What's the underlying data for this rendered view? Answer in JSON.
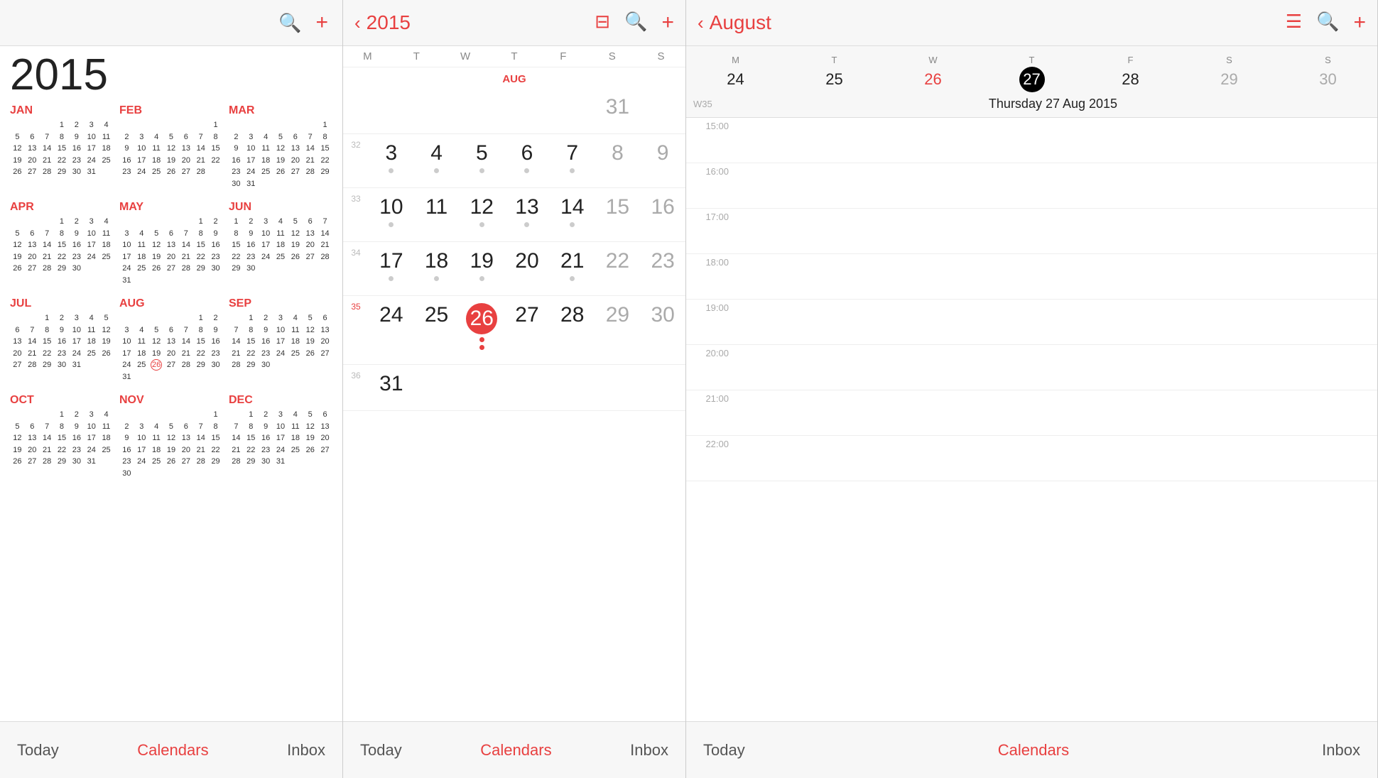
{
  "panel1": {
    "year": "2015",
    "toolbar": {
      "search_label": "search",
      "add_label": "add"
    },
    "months": [
      {
        "name": "JAN",
        "weeks": [
          [
            "",
            "",
            "",
            "1",
            "2",
            "3",
            "4"
          ],
          [
            "5",
            "6",
            "7",
            "8",
            "9",
            "10",
            "11"
          ],
          [
            "12",
            "13",
            "14",
            "15",
            "16",
            "17",
            "18"
          ],
          [
            "19",
            "20",
            "21",
            "22",
            "23",
            "24",
            "25"
          ],
          [
            "26",
            "27",
            "28",
            "29",
            "30",
            "31",
            ""
          ]
        ]
      },
      {
        "name": "FEB",
        "weeks": [
          [
            "",
            "",
            "",
            "",
            "",
            "",
            "1"
          ],
          [
            "2",
            "3",
            "4",
            "5",
            "6",
            "7",
            "8"
          ],
          [
            "9",
            "10",
            "11",
            "12",
            "13",
            "14",
            "15"
          ],
          [
            "16",
            "17",
            "18",
            "19",
            "20",
            "21",
            "22"
          ],
          [
            "23",
            "24",
            "25",
            "26",
            "27",
            "28",
            ""
          ]
        ]
      },
      {
        "name": "MAR",
        "weeks": [
          [
            "",
            "",
            "",
            "",
            "",
            "",
            "1"
          ],
          [
            "2",
            "3",
            "4",
            "5",
            "6",
            "7",
            "8"
          ],
          [
            "9",
            "10",
            "11",
            "12",
            "13",
            "14",
            "15"
          ],
          [
            "16",
            "17",
            "18",
            "19",
            "20",
            "21",
            "22"
          ],
          [
            "23",
            "24",
            "25",
            "26",
            "27",
            "28",
            "29"
          ],
          [
            "30",
            "31",
            "",
            "",
            "",
            "",
            ""
          ]
        ]
      },
      {
        "name": "APR",
        "weeks": [
          [
            "",
            "",
            "",
            "1",
            "2",
            "3",
            "4",
            "5"
          ],
          [
            "6",
            "7",
            "8",
            "9",
            "10",
            "11",
            "12"
          ],
          [
            "13",
            "14",
            "15",
            "16",
            "17",
            "18",
            "19"
          ],
          [
            "20",
            "21",
            "22",
            "23",
            "24",
            "25",
            "26"
          ],
          [
            "27",
            "28",
            "29",
            "30",
            "",
            "",
            ""
          ]
        ]
      },
      {
        "name": "MAY",
        "weeks": [
          [
            "",
            "",
            "",
            "",
            "",
            "1",
            "2",
            "3"
          ],
          [
            "4",
            "5",
            "6",
            "7",
            "8",
            "9",
            "10"
          ],
          [
            "11",
            "12",
            "13",
            "14",
            "15",
            "16",
            "17"
          ],
          [
            "18",
            "19",
            "20",
            "21",
            "22",
            "23",
            "24"
          ],
          [
            "25",
            "26",
            "27",
            "28",
            "29",
            "30",
            "31"
          ]
        ]
      },
      {
        "name": "JUN",
        "weeks": [
          [
            "1",
            "2",
            "3",
            "4",
            "5",
            "6",
            "7"
          ],
          [
            "8",
            "9",
            "10",
            "11",
            "12",
            "13",
            "14"
          ],
          [
            "15",
            "16",
            "17",
            "18",
            "19",
            "20",
            "21"
          ],
          [
            "22",
            "23",
            "24",
            "25",
            "26",
            "27",
            "28"
          ],
          [
            "29",
            "30",
            "",
            "",
            "",
            "",
            ""
          ]
        ]
      },
      {
        "name": "JUL",
        "weeks": [
          [
            "",
            "",
            "1",
            "2",
            "3",
            "4",
            "5"
          ],
          [
            "6",
            "7",
            "8",
            "9",
            "10",
            "11",
            "12"
          ],
          [
            "13",
            "14",
            "15",
            "16",
            "17",
            "18",
            "19"
          ],
          [
            "20",
            "21",
            "22",
            "23",
            "24",
            "25",
            "26"
          ],
          [
            "27",
            "28",
            "29",
            "30",
            "31",
            "",
            ""
          ]
        ]
      },
      {
        "name": "AUG",
        "weeks": [
          [
            "",
            "",
            "",
            "",
            "",
            "1",
            "2"
          ],
          [
            "3",
            "4",
            "5",
            "6",
            "7",
            "8",
            "9"
          ],
          [
            "10",
            "11",
            "12",
            "13",
            "14",
            "15",
            "16"
          ],
          [
            "17",
            "18",
            "19",
            "20",
            "21",
            "22",
            "23"
          ],
          [
            "24",
            "25",
            "26",
            "27",
            "28",
            "29",
            "30"
          ],
          [
            "31",
            "",
            "",
            "",
            "",
            "",
            ""
          ]
        ]
      },
      {
        "name": "SEP",
        "weeks": [
          [
            "",
            "1",
            "2",
            "3",
            "4",
            "5",
            "6"
          ],
          [
            "7",
            "8",
            "9",
            "10",
            "11",
            "12",
            "13"
          ],
          [
            "14",
            "15",
            "16",
            "17",
            "18",
            "19",
            "20"
          ],
          [
            "21",
            "22",
            "23",
            "24",
            "25",
            "26",
            "27"
          ],
          [
            "28",
            "29",
            "30",
            "",
            "",
            "",
            ""
          ]
        ]
      },
      {
        "name": "OCT",
        "weeks": [
          [
            "",
            "",
            "",
            "1",
            "2",
            "3",
            "4"
          ],
          [
            "5",
            "6",
            "7",
            "8",
            "9",
            "10",
            "11"
          ],
          [
            "12",
            "13",
            "14",
            "15",
            "16",
            "17",
            "18"
          ],
          [
            "19",
            "20",
            "21",
            "22",
            "23",
            "24",
            "25"
          ],
          [
            "26",
            "27",
            "28",
            "29",
            "30",
            "31",
            ""
          ]
        ]
      },
      {
        "name": "NOV",
        "weeks": [
          [
            "",
            "",
            "",
            "",
            "",
            "",
            "1"
          ],
          [
            "2",
            "3",
            "4",
            "5",
            "6",
            "7",
            "8"
          ],
          [
            "9",
            "10",
            "11",
            "12",
            "13",
            "14",
            "15"
          ],
          [
            "16",
            "17",
            "18",
            "19",
            "20",
            "21",
            "22"
          ],
          [
            "23",
            "24",
            "25",
            "26",
            "27",
            "28",
            "29"
          ],
          [
            "30",
            "",
            "",
            "",
            "",
            "",
            ""
          ]
        ]
      },
      {
        "name": "DEC",
        "weeks": [
          [
            "",
            "1",
            "2",
            "3",
            "4",
            "5",
            "6"
          ],
          [
            "7",
            "8",
            "9",
            "10",
            "11",
            "12",
            "13"
          ],
          [
            "14",
            "15",
            "16",
            "17",
            "18",
            "19",
            "20"
          ],
          [
            "21",
            "22",
            "23",
            "24",
            "25",
            "26",
            "27"
          ],
          [
            "28",
            "29",
            "30",
            "31",
            "",
            "",
            ""
          ]
        ]
      }
    ],
    "nav": {
      "today": "Today",
      "calendars": "Calendars",
      "inbox": "Inbox"
    }
  },
  "panel2": {
    "year": "2015",
    "month_name": "AUG",
    "dow_headers": [
      "M",
      "T",
      "W",
      "T",
      "F",
      "S",
      "S"
    ],
    "toolbar": {
      "back": "‹",
      "calendar_icon": "calendar",
      "search": "search",
      "add": "add"
    },
    "weeks": [
      {
        "week_num": "",
        "days": [
          {
            "num": "",
            "other": true
          },
          {
            "num": "",
            "other": true
          },
          {
            "num": "",
            "other": true
          },
          {
            "num": "",
            "other": true
          },
          {
            "num": "",
            "other": true
          },
          {
            "num": "31",
            "other": true
          },
          {
            "num": "",
            "other": true
          }
        ]
      },
      {
        "week_num": "32",
        "days": [
          {
            "num": "3",
            "other": false
          },
          {
            "num": "4",
            "other": false
          },
          {
            "num": "5",
            "other": false
          },
          {
            "num": "6",
            "other": false
          },
          {
            "num": "7",
            "other": false
          },
          {
            "num": "8",
            "weekend": true
          },
          {
            "num": "9",
            "weekend": true
          }
        ]
      },
      {
        "week_num": "33",
        "days": [
          {
            "num": "10",
            "other": false
          },
          {
            "num": "11",
            "other": false
          },
          {
            "num": "12",
            "other": false
          },
          {
            "num": "13",
            "other": false
          },
          {
            "num": "14",
            "other": false
          },
          {
            "num": "15",
            "weekend": true
          },
          {
            "num": "16",
            "weekend": true
          }
        ]
      },
      {
        "week_num": "34",
        "days": [
          {
            "num": "17",
            "other": false
          },
          {
            "num": "18",
            "other": false
          },
          {
            "num": "19",
            "other": false
          },
          {
            "num": "20",
            "other": false
          },
          {
            "num": "21",
            "other": false
          },
          {
            "num": "22",
            "weekend": true
          },
          {
            "num": "23",
            "weekend": true
          }
        ]
      },
      {
        "week_num": "35",
        "days": [
          {
            "num": "24",
            "other": false
          },
          {
            "num": "25",
            "other": false
          },
          {
            "num": "26",
            "selected": true
          },
          {
            "num": "27",
            "other": false
          },
          {
            "num": "28",
            "other": false
          },
          {
            "num": "29",
            "weekend": true
          },
          {
            "num": "30",
            "weekend": true
          }
        ]
      },
      {
        "week_num": "36",
        "days": [
          {
            "num": "31",
            "other": false
          },
          {
            "num": "",
            "other": true
          },
          {
            "num": "",
            "other": true
          },
          {
            "num": "",
            "other": true
          },
          {
            "num": "",
            "other": true
          },
          {
            "num": "",
            "other": true
          },
          {
            "num": "",
            "other": true
          }
        ]
      }
    ],
    "nav": {
      "today": "Today",
      "calendars": "Calendars",
      "inbox": "Inbox"
    }
  },
  "panel3": {
    "month_name": "August",
    "toolbar": {
      "back": "‹",
      "list_icon": "list",
      "search": "search",
      "add": "add"
    },
    "week_row": {
      "week_num": "W35",
      "date_title": "Thursday  27 Aug 2015",
      "days": [
        {
          "dow": "M",
          "date": "24",
          "style": "normal"
        },
        {
          "dow": "T",
          "date": "25",
          "style": "normal"
        },
        {
          "dow": "W",
          "date": "26",
          "style": "red"
        },
        {
          "dow": "T",
          "date": "27",
          "style": "today"
        },
        {
          "dow": "F",
          "date": "28",
          "style": "normal"
        },
        {
          "dow": "S",
          "date": "29",
          "style": "gray"
        },
        {
          "dow": "S",
          "date": "30",
          "style": "gray"
        }
      ]
    },
    "hours": [
      "15:00",
      "16:00",
      "17:00",
      "18:00",
      "19:00",
      "20:00",
      "21:00",
      "22:00"
    ],
    "nav": {
      "today": "Today",
      "calendars": "Calendars",
      "inbox": "Inbox"
    }
  }
}
